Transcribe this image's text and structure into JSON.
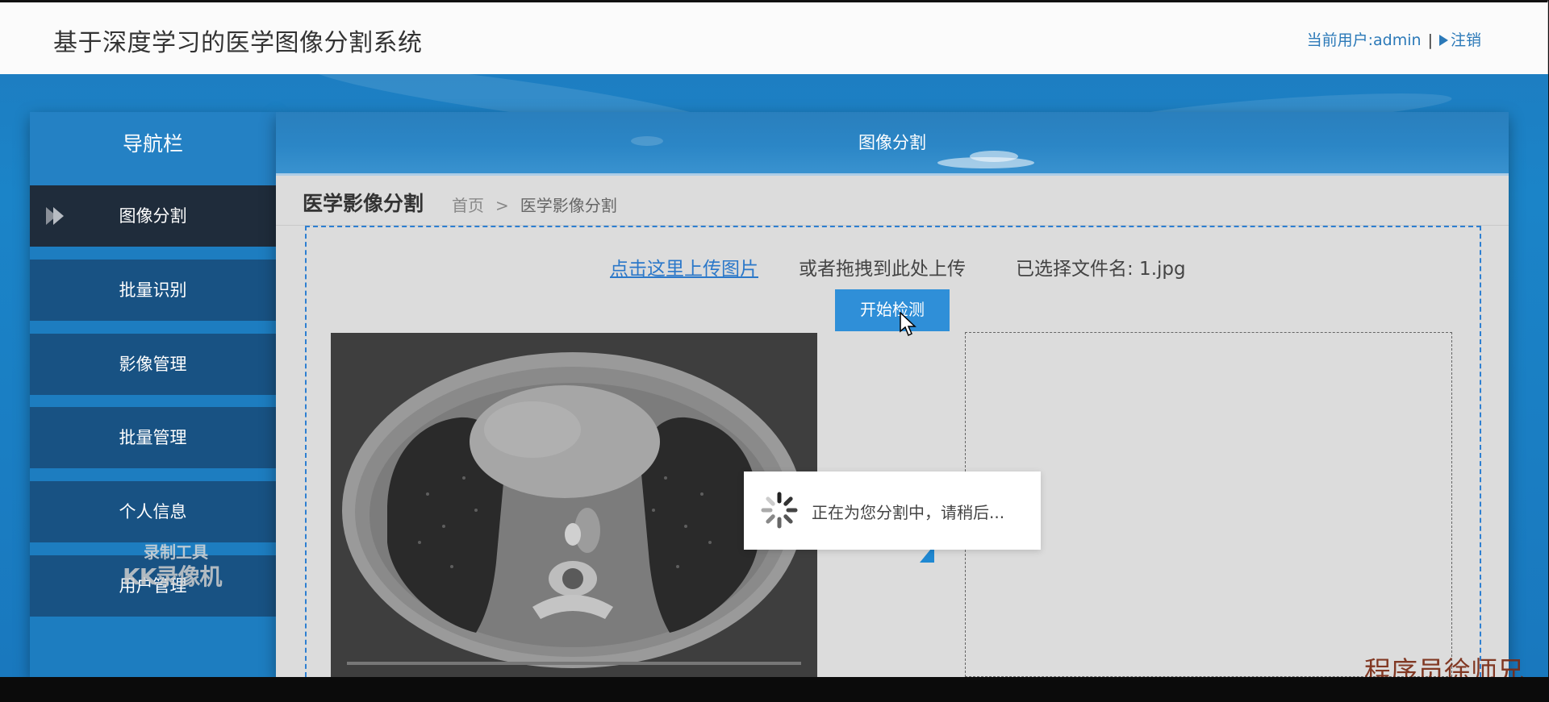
{
  "header": {
    "app_title": "基于深度学习的医学图像分割系统",
    "current_user_text": "当前用户:admin",
    "separator": "|",
    "logout_label": "注销"
  },
  "nav": {
    "title": "导航栏",
    "items": [
      {
        "label": "图像分割",
        "active": true
      },
      {
        "label": "批量识别"
      },
      {
        "label": "影像管理"
      },
      {
        "label": "批量管理"
      },
      {
        "label": "个人信息"
      },
      {
        "label": "用户管理"
      }
    ]
  },
  "panel": {
    "header_title": "图像分割",
    "page_title": "医学影像分割",
    "breadcrumb": {
      "home": "首页",
      "separator": ">",
      "current": "医学影像分割"
    }
  },
  "upload": {
    "link_label": "点击这里上传图片",
    "drag_hint": "或者拖拽到此处上传",
    "selected_file_text": "已选择文件名: 1.jpg",
    "start_button": "开始检测"
  },
  "loading": {
    "text": "正在为您分割中，请稍后..."
  },
  "watermarks": {
    "recorder_line1": "录制工具",
    "recorder_line2": "KK录像机",
    "author": "程序员徐师兄"
  },
  "colors": {
    "brand_blue": "#1d7ec2",
    "nav_item": "#185283",
    "nav_active": "#1f2c3b",
    "link": "#2b78c9",
    "button": "#2f8fd8"
  }
}
